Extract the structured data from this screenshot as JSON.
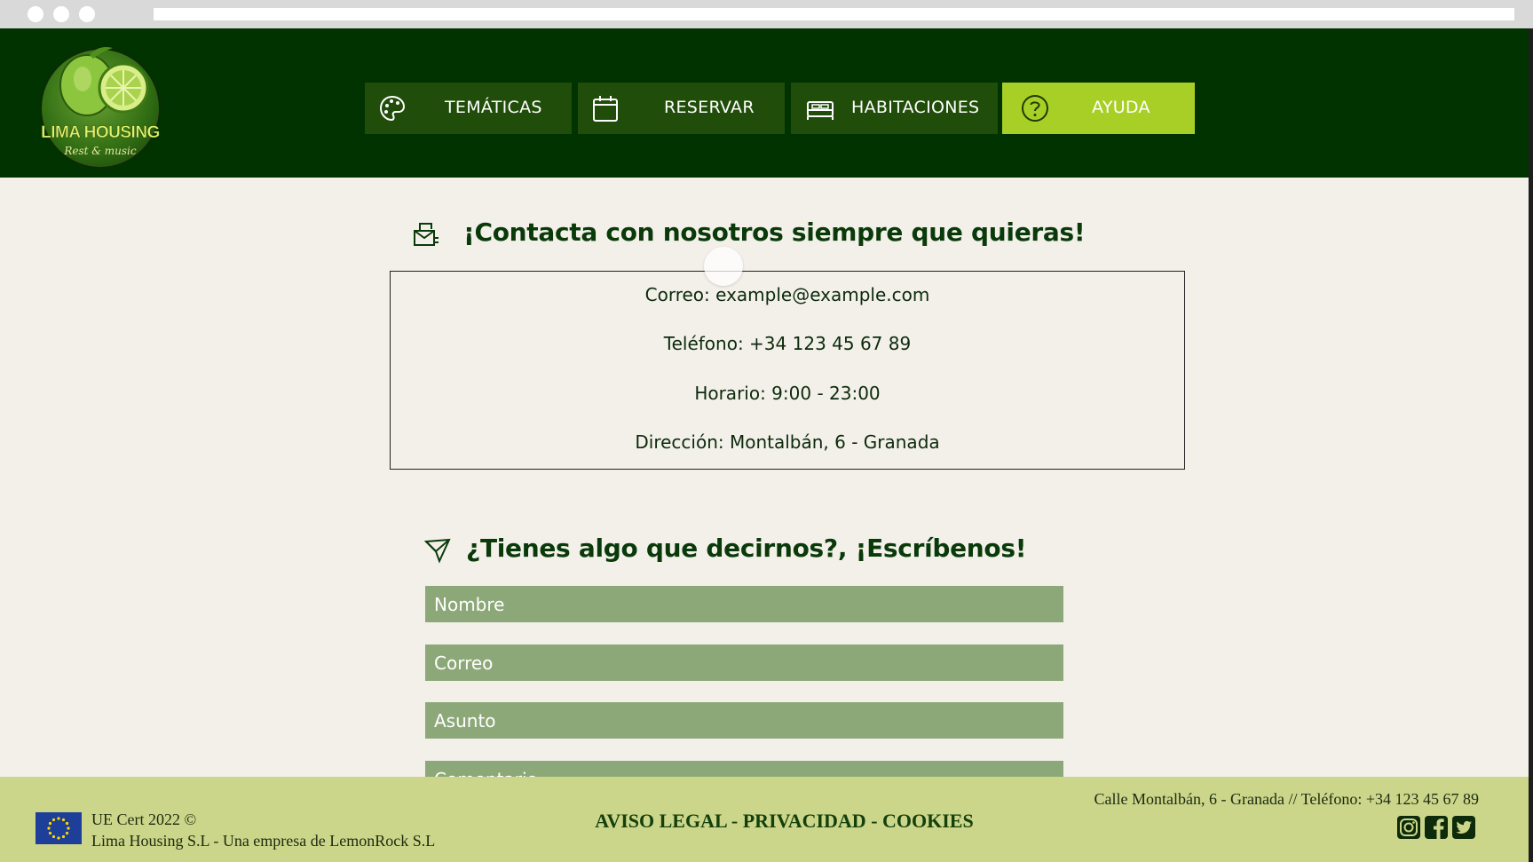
{
  "browser": {
    "window_controls": [
      "close",
      "minimize",
      "maximize"
    ]
  },
  "header": {
    "logo": {
      "name": "LIMA HOUSING",
      "tagline": "Rest & music"
    },
    "nav": [
      {
        "label": "TEMÁTICAS",
        "icon": "palette-icon",
        "active": false
      },
      {
        "label": "RESERVAR",
        "icon": "calendar-icon",
        "active": false
      },
      {
        "label": "HABITACIONES",
        "icon": "bed-icon",
        "active": false
      },
      {
        "label": "AYUDA",
        "icon": "question-circle-icon",
        "active": true
      }
    ]
  },
  "contact": {
    "title": "¡Contacta con nosotros siempre que quieras!",
    "icon": "mailbox-icon",
    "lines": [
      "Correo: example@example.com",
      "Teléfono: +34 123 45 67 89",
      "Horario: 9:00 - 23:00",
      "Dirección: Montalbán, 6 - Granada"
    ]
  },
  "form": {
    "title": "¿Tienes algo que decirnos?, ¡Escríbenos!",
    "icon": "paper-plane-icon",
    "fields": [
      {
        "placeholder": "Nombre",
        "value": ""
      },
      {
        "placeholder": "Correo",
        "value": ""
      },
      {
        "placeholder": "Asunto",
        "value": ""
      },
      {
        "placeholder": "Comentario",
        "value": ""
      }
    ]
  },
  "footer": {
    "cert": "UE Cert 2022 ©",
    "company": "Lima Housing S.L - Una empresa de LemonRock S.L",
    "links": "AVISO LEGAL - PRIVACIDAD - COOKIES",
    "address": "Calle Montalbán, 6 - Granada  // Teléfono: +34 123 45 67 89",
    "social": [
      "instagram-icon",
      "facebook-icon",
      "twitter-icon"
    ]
  },
  "colors": {
    "header_bg": "#003300",
    "nav_bg": "#214d0a",
    "nav_active": "#a8cf25",
    "page_bg": "#f3f0ea",
    "input_bg": "#8da878",
    "footer_bg": "#ccd68a",
    "title_text": "#0a3a0a"
  }
}
